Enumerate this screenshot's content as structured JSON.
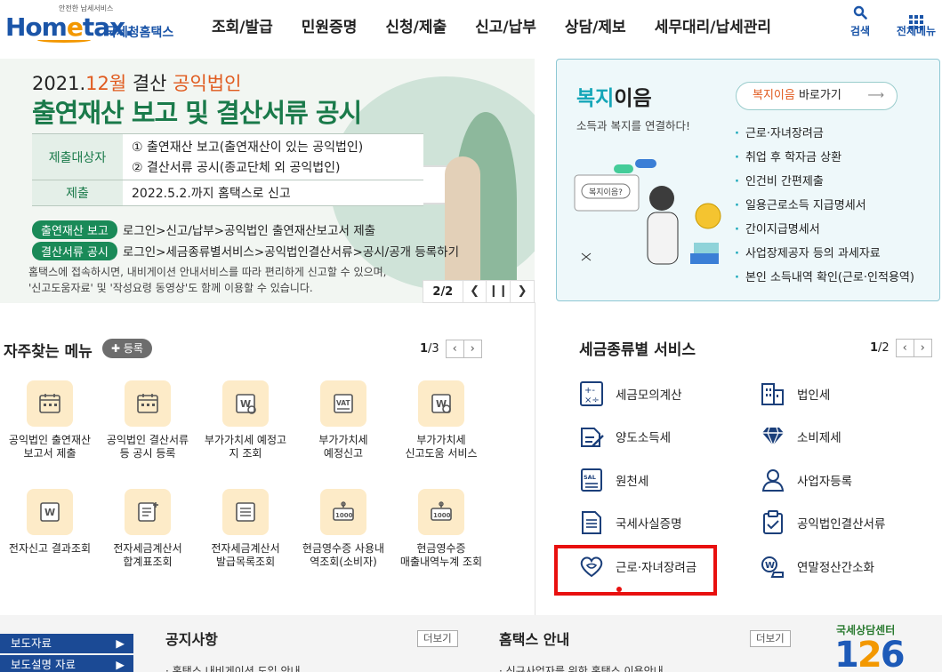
{
  "header": {
    "logo_tag": "안전한 납세서비스",
    "logo_main_1": "Hom",
    "logo_main_e": "e",
    "logo_main_2": "tax.",
    "logo_sub": "국세청홈택스",
    "nav": [
      "조회/발급",
      "민원증명",
      "신청/제출",
      "신고/납부",
      "상담/제보",
      "세무대리/납세관리"
    ],
    "search_label": "검색",
    "allmenu_label": "전체메뉴"
  },
  "banner": {
    "title1_pre": "2021.",
    "title1_red1": "12월",
    "title1_mid": " 결산 ",
    "title1_red2": "공익법인",
    "title2": "출연재산 보고 및 결산서류 공시",
    "rows": [
      {
        "head": "제출대상자",
        "line1": "① 출연재산 보고(출연재산이 있는 공익법인)",
        "line2": "② 결산서류 공시(종교단체 외 공익법인)"
      },
      {
        "head": "제출",
        "line1": "2022.5.2.까지 홈택스로 신고"
      }
    ],
    "chip1": "출연재산 보고",
    "chip1_text": "로그인>신고/납부>공익법인 출연재산보고서 제출",
    "chip2": "결산서류 공시",
    "chip2_text": "로그인>세금종류별서비스>공익법인결산서류>공시/공개 등록하기",
    "note1": "홈택스에 접속하시면, 내비게이션 안내서비스를 따라 편리하게 신고할 수 있으며,",
    "note2": "'신고도움자료' 및 '작성요령 동영상'도 함께 이용할 수 있습니다.",
    "pager_current": "2",
    "pager_total": "/2"
  },
  "welfare": {
    "title_color": "복지",
    "title_dark": "이음",
    "subtitle": "소득과 복지를 연결하다!",
    "link_orange": "복지이음",
    "link_rest": " 바로가기",
    "link_arrow": "⟶",
    "bubble": "복지이음?",
    "items": [
      "근로·자녀장려금",
      "취업 후 학자금 상환",
      "인건비 간편제출",
      "일용근로소득 지급명세서",
      "간이지급명세서",
      "사업장제공자 등의 과세자료",
      "본인 소득내역 확인(근로·인적용역)"
    ]
  },
  "favorites": {
    "title": "자주찾는 메뉴",
    "add_label": "✚ 등록",
    "page_current": "1",
    "page_total": "/3",
    "items": [
      {
        "label1": "공익법인 출연재산",
        "label2": "보고서 제출"
      },
      {
        "label1": "공익법인 결산서류",
        "label2": "등 공시 등록"
      },
      {
        "label1": "부가가치세 예정고",
        "label2": "지 조회"
      },
      {
        "label1": "부가가치세",
        "label2": "예정신고"
      },
      {
        "label1": "부가가치세",
        "label2": "신고도움 서비스"
      },
      {
        "label1": "전자신고 결과조회",
        "label2": ""
      },
      {
        "label1": "전자세금계산서",
        "label2": "합계표조회"
      },
      {
        "label1": "전자세금계산서",
        "label2": "발급목록조회"
      },
      {
        "label1": "현금영수증 사용내",
        "label2": "역조회(소비자)"
      },
      {
        "label1": "현금영수증",
        "label2": "매출내역누계 조회"
      }
    ]
  },
  "tax_services": {
    "title": "세금종류별 서비스",
    "page_current": "1",
    "page_total": "/2",
    "left": [
      "세금모의계산",
      "양도소득세",
      "원천세",
      "국세사실증명",
      "근로·자녀장려금"
    ],
    "right": [
      "법인세",
      "소비제세",
      "사업자등록",
      "공익법인결산서류",
      "연말정산간소화"
    ]
  },
  "bottom": {
    "press1": "보도자료",
    "press2": "보도설명 자료",
    "notice_title": "공지사항",
    "notice_more": "더보기",
    "notice_first": "· 홈택스 내비게이션 도입 안내",
    "guide_title": "홈택스 안내",
    "guide_more": "더보기",
    "guide_first": "· 신규사업자를 위한 홈택스 이용안내",
    "center_text": "국세상담센터",
    "center_big_1": "1",
    "center_big_2": "2",
    "center_big_3": "6"
  },
  "colors": {
    "brand_blue": "#1b55a8",
    "brand_orange": "#f39800",
    "banner_green": "#1a7a4a",
    "welfare_teal": "#15a6b8",
    "highlight_red": "#e8100f"
  }
}
